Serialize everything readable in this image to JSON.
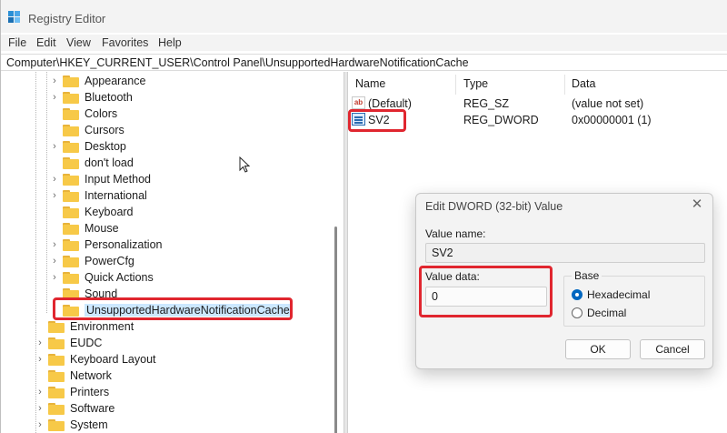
{
  "window": {
    "title": "Registry Editor"
  },
  "menu": [
    "File",
    "Edit",
    "View",
    "Favorites",
    "Help"
  ],
  "address": "Computer\\HKEY_CURRENT_USER\\Control Panel\\UnsupportedHardwareNotificationCache",
  "tree": {
    "items": [
      {
        "label": "Appearance",
        "expander": true
      },
      {
        "label": "Bluetooth",
        "expander": true
      },
      {
        "label": "Colors",
        "expander": false
      },
      {
        "label": "Cursors",
        "expander": false
      },
      {
        "label": "Desktop",
        "expander": true
      },
      {
        "label": "don't load",
        "expander": false
      },
      {
        "label": "Input Method",
        "expander": true
      },
      {
        "label": "International",
        "expander": true
      },
      {
        "label": "Keyboard",
        "expander": false
      },
      {
        "label": "Mouse",
        "expander": false
      },
      {
        "label": "Personalization",
        "expander": true
      },
      {
        "label": "PowerCfg",
        "expander": true
      },
      {
        "label": "Quick Actions",
        "expander": true
      },
      {
        "label": "Sound",
        "expander": false
      },
      {
        "label": "UnsupportedHardwareNotificationCache",
        "expander": false,
        "selected": true
      },
      {
        "label": "Environment",
        "expander": false
      },
      {
        "label": "EUDC",
        "expander": true
      },
      {
        "label": "Keyboard Layout",
        "expander": true
      },
      {
        "label": "Network",
        "expander": false
      },
      {
        "label": "Printers",
        "expander": true
      },
      {
        "label": "Software",
        "expander": true
      },
      {
        "label": "System",
        "expander": true
      }
    ]
  },
  "values": {
    "headers": {
      "name": "Name",
      "type": "Type",
      "data": "Data"
    },
    "rows": [
      {
        "icon": "string-value-icon",
        "name": "(Default)",
        "type": "REG_SZ",
        "data": "(value not set)"
      },
      {
        "icon": "binary-value-icon",
        "name": "SV2",
        "type": "REG_DWORD",
        "data": "0x00000001 (1)"
      }
    ]
  },
  "dialog": {
    "title": "Edit DWORD (32-bit) Value",
    "value_name_label": "Value name:",
    "value_name": "SV2",
    "value_data_label": "Value data:",
    "value_data": "0",
    "base_label": "Base",
    "hex_label": "Hexadecimal",
    "dec_label": "Decimal",
    "base_selected": "Hexadecimal",
    "ok_label": "OK",
    "cancel_label": "Cancel"
  },
  "colors": {
    "highlight_box": "#e0262f",
    "selection": "#cce8ff",
    "accent": "#0067c0",
    "folder": "#f7c948"
  }
}
